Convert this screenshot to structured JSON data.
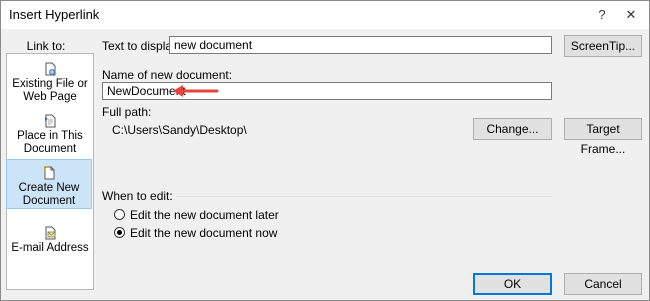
{
  "window": {
    "title": "Insert Hyperlink",
    "help_glyph": "?",
    "close_glyph": "✕"
  },
  "link_to": {
    "label": "Link to:",
    "items": [
      {
        "line1": "Existing File or",
        "line2": "Web Page",
        "icon": "existing-file-icon",
        "selected": false
      },
      {
        "line1": "Place in This",
        "line2": "Document",
        "icon": "place-in-document-icon",
        "selected": false
      },
      {
        "line1": "Create New",
        "line2": "Document",
        "icon": "create-new-document-icon",
        "selected": true
      },
      {
        "line1": "E-mail Address",
        "line2": "",
        "icon": "email-address-icon",
        "selected": false
      }
    ]
  },
  "form": {
    "text_to_display_label": "Text to display:",
    "text_to_display_value": "new document",
    "screentip_label": "ScreenTip...",
    "name_label": "Name of new document:",
    "name_value": "NewDocument",
    "full_path_label": "Full path:",
    "full_path_value": "C:\\Users\\Sandy\\Desktop\\",
    "change_label": "Change...",
    "target_frame_label": "Target Frame...",
    "when_to_edit_label": "When to edit:",
    "edit_later_label": "Edit the new document later",
    "edit_now_label": "Edit the new document now",
    "edit_selected": "now"
  },
  "buttons": {
    "ok": "OK",
    "cancel": "Cancel"
  },
  "colors": {
    "accent": "#0078d7",
    "annotation_arrow": "#e8453c",
    "selected_bg": "#cce4f7"
  }
}
